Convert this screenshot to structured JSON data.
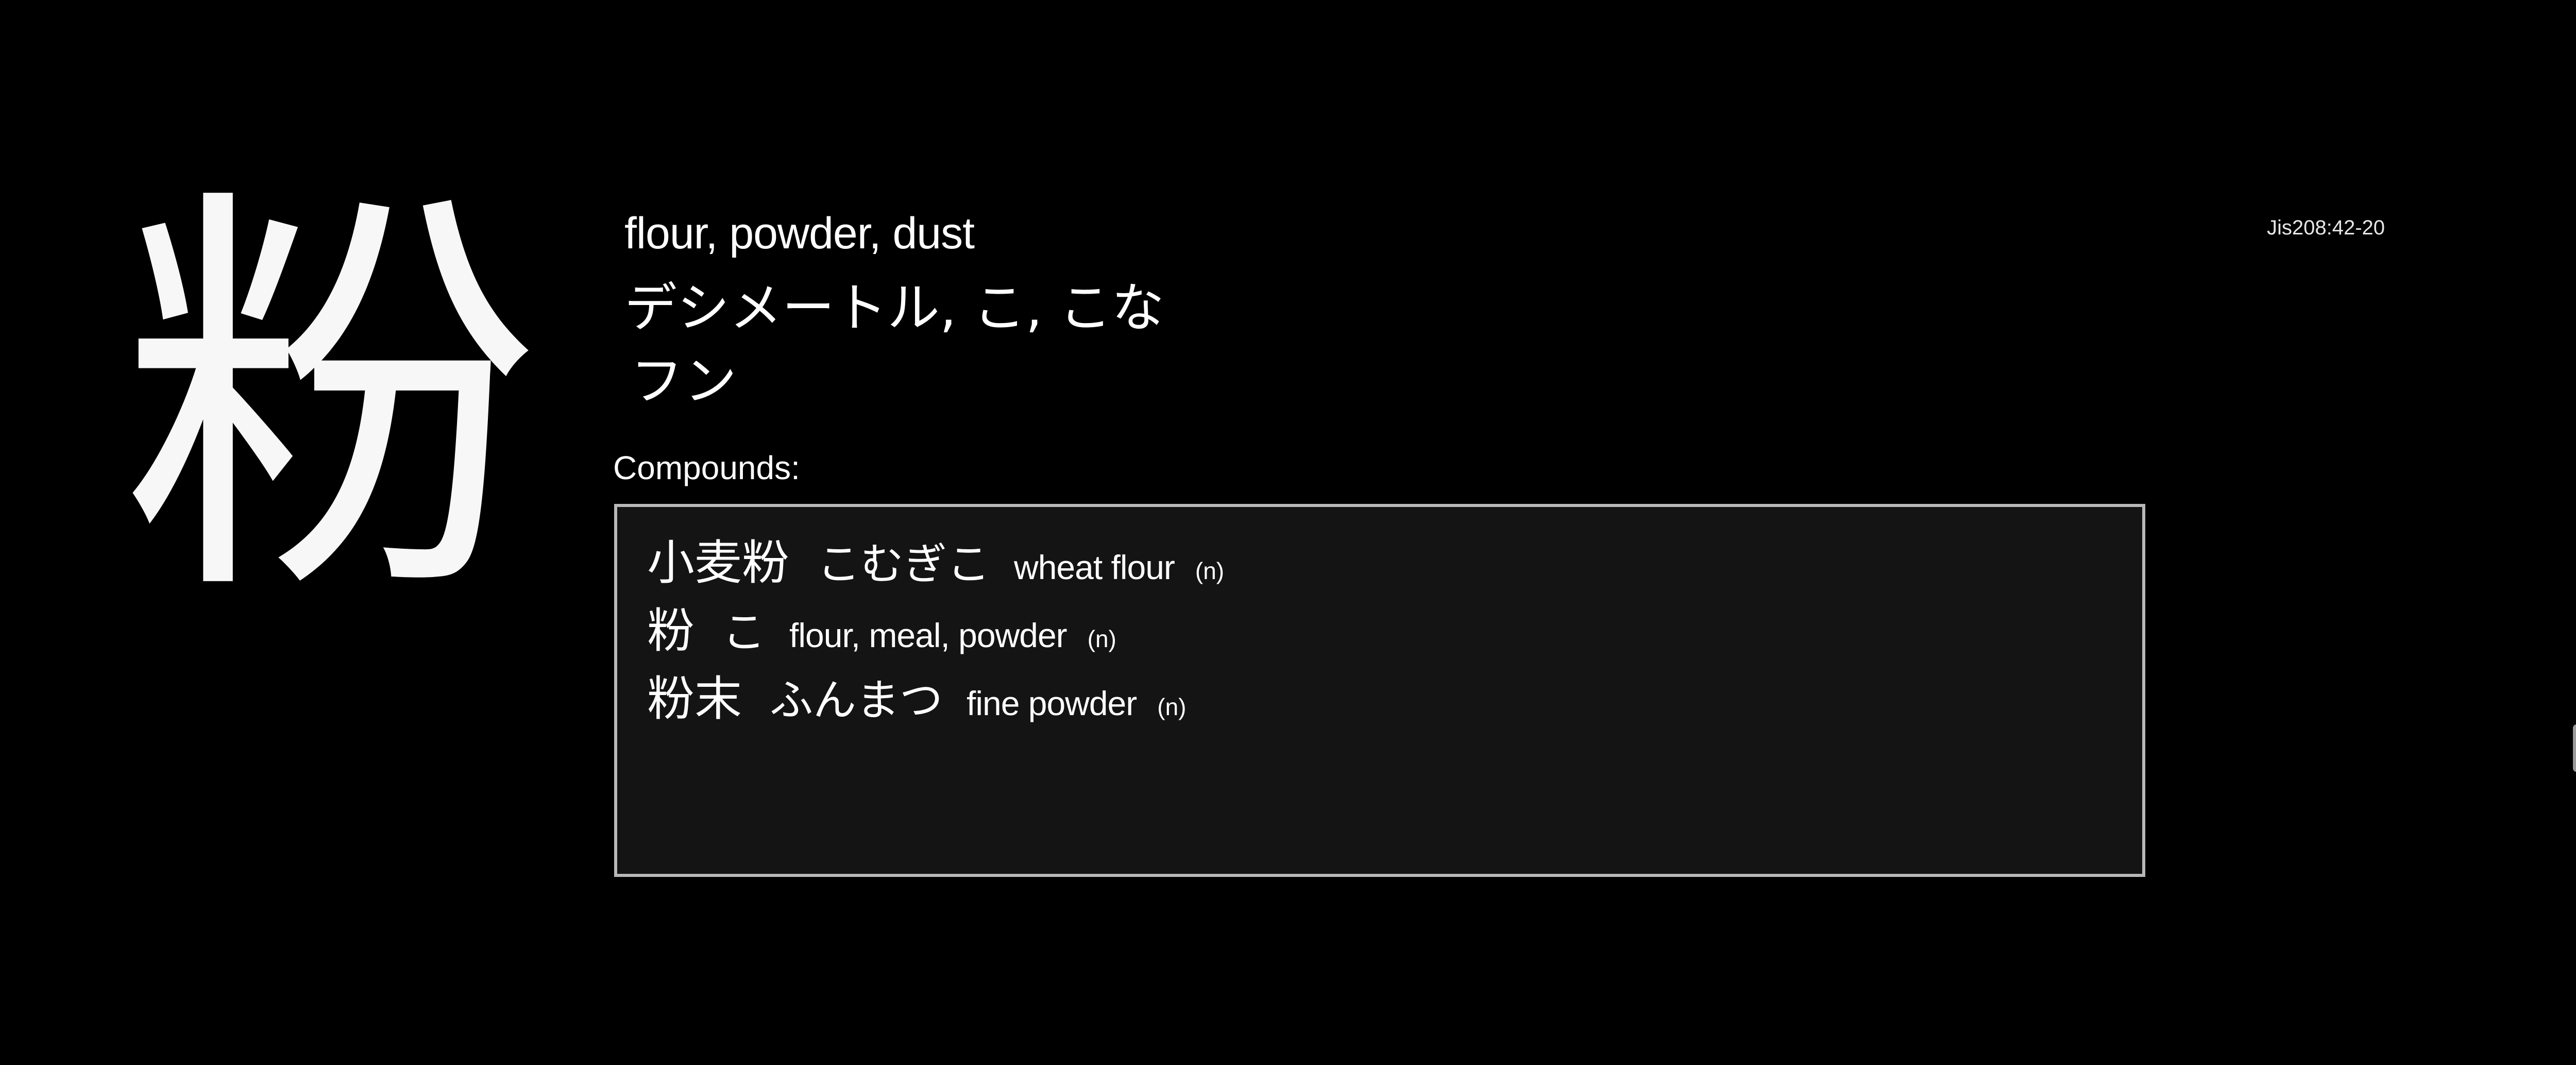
{
  "kanji": {
    "character": "粉",
    "meanings": "flour, powder, dust",
    "kun_readings": "デシメートル, こ, こな",
    "on_readings": "フン",
    "jis_code": "Jis208:42-20"
  },
  "compounds": {
    "label": "Compounds:",
    "items": [
      {
        "word": "小麦粉",
        "reading": "こむぎこ",
        "meaning": "wheat flour",
        "pos": "(n)"
      },
      {
        "word": "粉",
        "reading": "こ",
        "meaning": "flour, meal, powder",
        "pos": "(n)"
      },
      {
        "word": "粉末",
        "reading": "ふんまつ",
        "meaning": "fine powder",
        "pos": "(n)"
      }
    ]
  },
  "colors": {
    "background": "#000000",
    "text": "#ffffff",
    "box_background": "#141414",
    "box_border": "#b8b8b8"
  }
}
